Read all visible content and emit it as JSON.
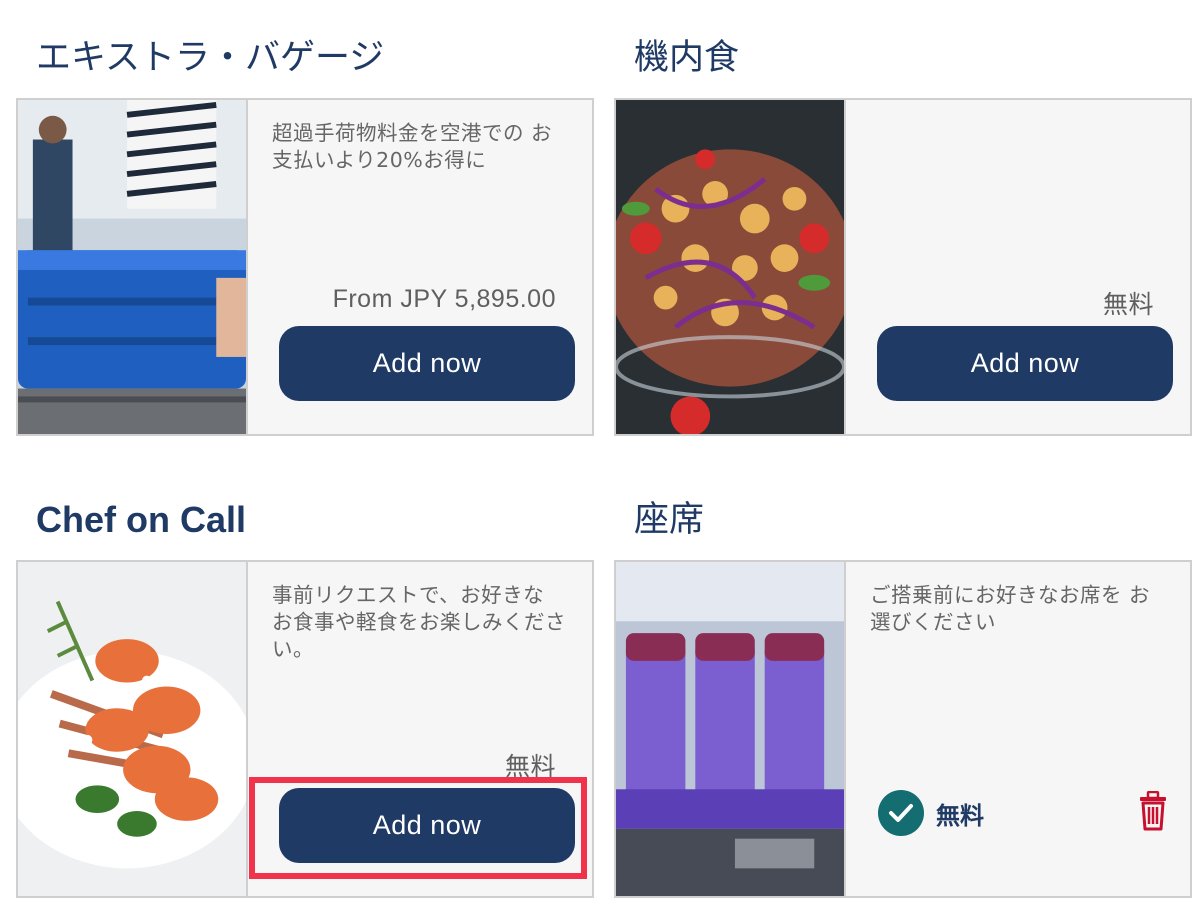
{
  "sections": [
    {
      "title": "エキストラ・バゲージ",
      "description": "超過手荷物料金を空港での お支払いより20%お得に",
      "price": "From JPY 5,895.00",
      "button_label": "Add now"
    },
    {
      "title": "機内食",
      "description": "",
      "price": "無料",
      "button_label": "Add now"
    },
    {
      "title": "Chef on Call",
      "description": "事前リクエストで、お好きな お食事や軽食をお楽しみください。",
      "price": "無料",
      "button_label": "Add now"
    },
    {
      "title": "座席",
      "description": "ご搭乗前にお好きなお席を お選びください",
      "selected_label": "無料"
    }
  ],
  "icons": {
    "check": "check-icon",
    "trash": "trash-icon"
  },
  "colors": {
    "primary": "#1f3a64",
    "check_bg": "#136d71",
    "delete": "#c8102e",
    "highlight": "#f0324a"
  }
}
